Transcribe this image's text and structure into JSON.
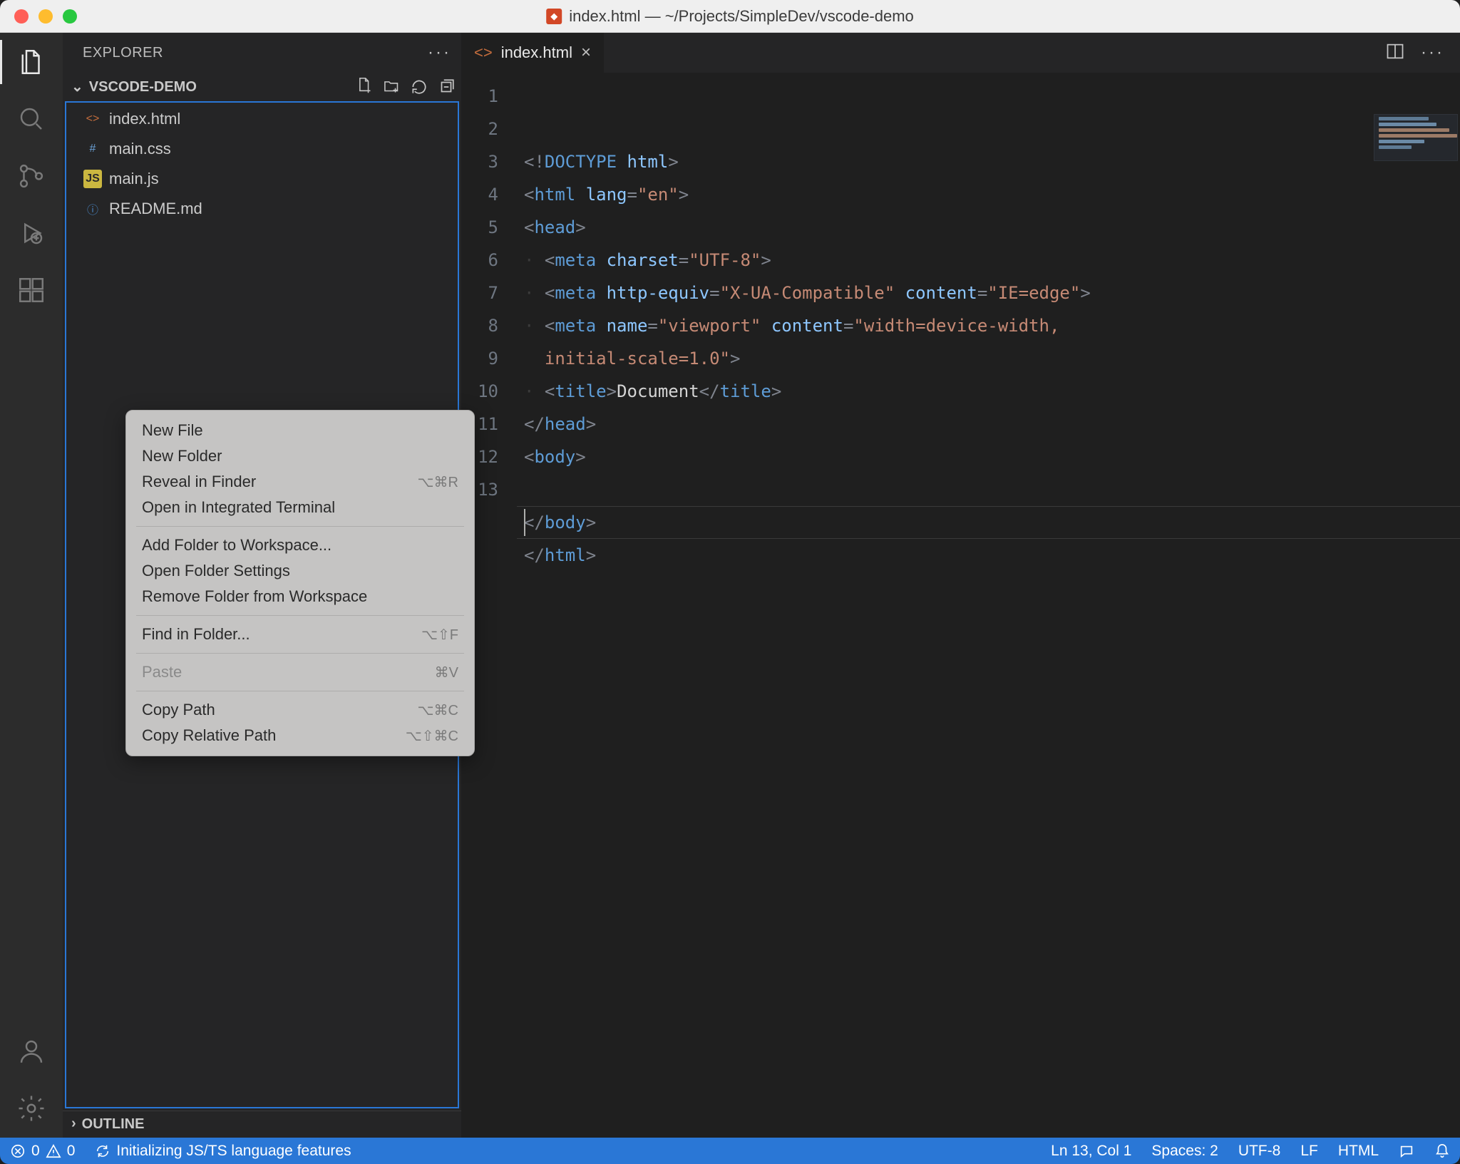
{
  "titlebar": {
    "title": "index.html — ~/Projects/SimpleDev/vscode-demo"
  },
  "sidebar": {
    "header": "EXPLORER",
    "folder": "VSCODE-DEMO",
    "files": [
      {
        "name": "index.html",
        "icon": "html"
      },
      {
        "name": "main.css",
        "icon": "css"
      },
      {
        "name": "main.js",
        "icon": "js"
      },
      {
        "name": "README.md",
        "icon": "info"
      }
    ],
    "outline": "OUTLINE"
  },
  "tabs": {
    "active": {
      "label": "index.html"
    }
  },
  "editor": {
    "line_numbers": [
      "1",
      "2",
      "3",
      "4",
      "5",
      "6",
      "",
      "7",
      "8",
      "9",
      "10",
      "11",
      "12",
      "13"
    ],
    "code_html": "<span class=\"c-punc\">&lt;!</span><span class=\"c-doctype-kw\">DOCTYPE</span> <span class=\"c-attr\">html</span><span class=\"c-punc\">&gt;</span>\n<span class=\"c-punc\">&lt;</span><span class=\"c-tag\">html</span> <span class=\"c-attr\">lang</span><span class=\"c-punc\">=</span><span class=\"c-str\">\"en\"</span><span class=\"c-punc\">&gt;</span>\n<span class=\"c-punc\">&lt;</span><span class=\"c-tag\">head</span><span class=\"c-punc\">&gt;</span>\n<span class=\"indent-guide\">·</span> <span class=\"c-punc\">&lt;</span><span class=\"c-tag\">meta</span> <span class=\"c-attr\">charset</span><span class=\"c-punc\">=</span><span class=\"c-str\">\"UTF-8\"</span><span class=\"c-punc\">&gt;</span>\n<span class=\"indent-guide\">·</span> <span class=\"c-punc\">&lt;</span><span class=\"c-tag\">meta</span> <span class=\"c-attr\">http-equiv</span><span class=\"c-punc\">=</span><span class=\"c-str\">\"X-UA-Compatible\"</span> <span class=\"c-attr\">content</span><span class=\"c-punc\">=</span><span class=\"c-str\">\"IE=edge\"</span><span class=\"c-punc\">&gt;</span>\n<span class=\"indent-guide\">·</span> <span class=\"c-punc\">&lt;</span><span class=\"c-tag\">meta</span> <span class=\"c-attr\">name</span><span class=\"c-punc\">=</span><span class=\"c-str\">\"viewport\"</span> <span class=\"c-attr\">content</span><span class=\"c-punc\">=</span><span class=\"c-str\">\"width=device-width, </span>\n  <span class=\"c-str\">initial-scale=1.0\"</span><span class=\"c-punc\">&gt;</span>\n<span class=\"indent-guide\">·</span> <span class=\"c-punc\">&lt;</span><span class=\"c-tag\">title</span><span class=\"c-punc\">&gt;</span><span class=\"c-text\">Document</span><span class=\"c-punc\">&lt;/</span><span class=\"c-tag\">title</span><span class=\"c-punc\">&gt;</span>\n<span class=\"c-punc\">&lt;/</span><span class=\"c-tag\">head</span><span class=\"c-punc\">&gt;</span>\n<span class=\"c-punc\">&lt;</span><span class=\"c-tag\">body</span><span class=\"c-punc\">&gt;</span>\n  \n<span class=\"c-punc\">&lt;/</span><span class=\"c-tag\">body</span><span class=\"c-punc\">&gt;</span>\n<span class=\"c-punc\">&lt;/</span><span class=\"c-tag\">html</span><span class=\"c-punc\">&gt;</span>\n"
  },
  "context_menu": {
    "groups": [
      [
        {
          "label": "New File",
          "shortcut": ""
        },
        {
          "label": "New Folder",
          "shortcut": ""
        },
        {
          "label": "Reveal in Finder",
          "shortcut": "⌥⌘R"
        },
        {
          "label": "Open in Integrated Terminal",
          "shortcut": ""
        }
      ],
      [
        {
          "label": "Add Folder to Workspace...",
          "shortcut": ""
        },
        {
          "label": "Open Folder Settings",
          "shortcut": ""
        },
        {
          "label": "Remove Folder from Workspace",
          "shortcut": ""
        }
      ],
      [
        {
          "label": "Find in Folder...",
          "shortcut": "⌥⇧F"
        }
      ],
      [
        {
          "label": "Paste",
          "shortcut": "⌘V",
          "disabled": true
        }
      ],
      [
        {
          "label": "Copy Path",
          "shortcut": "⌥⌘C"
        },
        {
          "label": "Copy Relative Path",
          "shortcut": "⌥⇧⌘C"
        }
      ]
    ]
  },
  "statusbar": {
    "errors": "0",
    "warnings": "0",
    "background_task": "Initializing JS/TS language features",
    "cursor": "Ln 13, Col 1",
    "spaces": "Spaces: 2",
    "encoding": "UTF-8",
    "eol": "LF",
    "language": "HTML"
  }
}
